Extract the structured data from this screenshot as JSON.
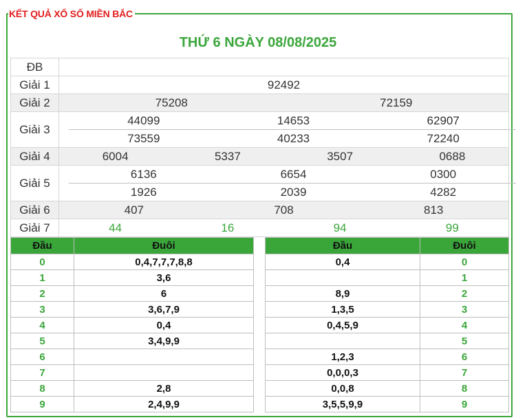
{
  "header": {
    "legend": "KẾT QUẢ XỔ SỐ MIỀN BẮC",
    "date_title": "THỨ 6 NGÀY 08/08/2025"
  },
  "results": [
    {
      "label": "ĐB",
      "rows": [
        [
          ""
        ]
      ]
    },
    {
      "label": "Giải 1",
      "rows": [
        [
          "92492"
        ]
      ]
    },
    {
      "label": "Giải 2",
      "rows": [
        [
          "75208",
          "72159"
        ]
      ]
    },
    {
      "label": "Giải 3",
      "rows": [
        [
          "44099",
          "14653",
          "62907"
        ],
        [
          "73559",
          "40233",
          "72240"
        ]
      ]
    },
    {
      "label": "Giải 4",
      "rows": [
        [
          "6004",
          "5337",
          "3507",
          "0688"
        ]
      ]
    },
    {
      "label": "Giải 5",
      "rows": [
        [
          "6136",
          "6654",
          "0300"
        ],
        [
          "1926",
          "2039",
          "4282"
        ]
      ]
    },
    {
      "label": "Giải 6",
      "rows": [
        [
          "407",
          "708",
          "813"
        ]
      ]
    },
    {
      "label": "Giải 7",
      "rows": [
        [
          "44",
          "16",
          "94",
          "99"
        ]
      ]
    }
  ],
  "loto_head": {
    "headers": {
      "dau": "Đầu",
      "duoi": "Đuôi"
    },
    "rows": [
      {
        "key": "0",
        "value": "0,4,7,7,7,8,8"
      },
      {
        "key": "1",
        "value": "3,6"
      },
      {
        "key": "2",
        "value": "6"
      },
      {
        "key": "3",
        "value": "3,6,7,9"
      },
      {
        "key": "4",
        "value": "0,4"
      },
      {
        "key": "5",
        "value": "3,4,9,9"
      },
      {
        "key": "6",
        "value": ""
      },
      {
        "key": "7",
        "value": ""
      },
      {
        "key": "8",
        "value": "2,8"
      },
      {
        "key": "9",
        "value": "2,4,9,9"
      }
    ]
  },
  "loto_tail": {
    "headers": {
      "dau": "Đầu",
      "duoi": "Đuôi"
    },
    "rows": [
      {
        "key": "0",
        "value": "0,4"
      },
      {
        "key": "1",
        "value": ""
      },
      {
        "key": "2",
        "value": "8,9"
      },
      {
        "key": "3",
        "value": "1,3,5"
      },
      {
        "key": "4",
        "value": "0,4,5,9"
      },
      {
        "key": "5",
        "value": ""
      },
      {
        "key": "6",
        "value": "1,2,3"
      },
      {
        "key": "7",
        "value": "0,0,0,3"
      },
      {
        "key": "8",
        "value": "0,0,8"
      },
      {
        "key": "9",
        "value": "3,5,5,9,9"
      }
    ]
  },
  "colors": {
    "accent": "#3aa63a",
    "legend": "#e21d1d",
    "row_shade": "#efefef"
  }
}
